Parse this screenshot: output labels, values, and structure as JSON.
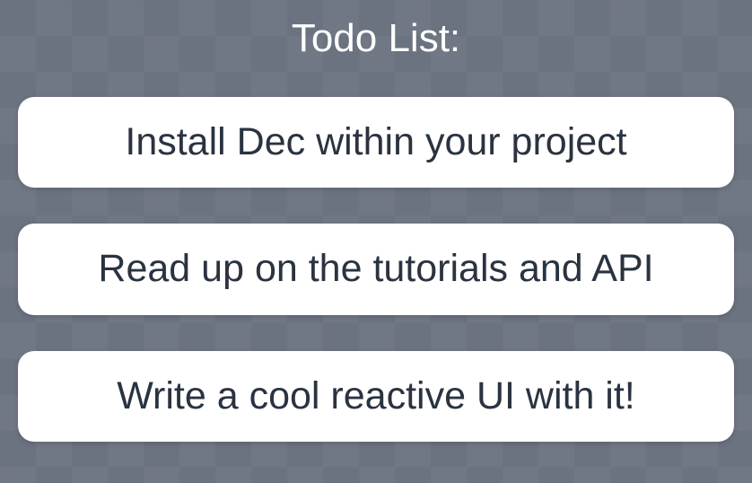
{
  "title": "Todo List:",
  "items": [
    {
      "text": "Install Dec within your project"
    },
    {
      "text": "Read up on the tutorials and API"
    },
    {
      "text": "Write a cool reactive UI with it!"
    }
  ]
}
